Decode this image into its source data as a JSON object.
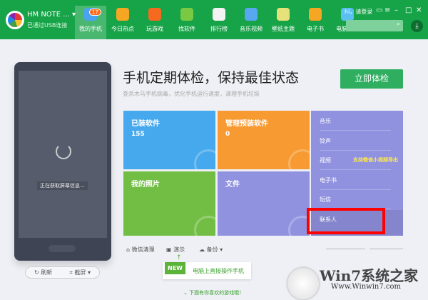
{
  "header": {
    "device": "HM NOTE ...",
    "usb": "已通过USB连接",
    "login": "hi，请登录",
    "badge": "17",
    "nav": [
      {
        "label": "我的手机",
        "color": "#4aa3f0"
      },
      {
        "label": "今日热点",
        "color": "#f5a623"
      },
      {
        "label": "玩游戏",
        "color": "#f56a1e"
      },
      {
        "label": "找软件",
        "color": "#7ac943"
      },
      {
        "label": "排行榜",
        "color": "#f3f3f3"
      },
      {
        "label": "音乐视频",
        "color": "#57a8f0"
      },
      {
        "label": "壁纸主题",
        "color": "#e6e27a"
      },
      {
        "label": "电子书",
        "color": "#f5a623"
      },
      {
        "label": "电脑软件",
        "color": "#5bc0f0"
      }
    ]
  },
  "phone": {
    "loading": "正在获取屏幕信息...",
    "refresh": "刷新",
    "screenshot": "截屏"
  },
  "main": {
    "title": "手机定期体检，保持最佳状态",
    "subtitle": "查杀木马手机病毒，优化手机运行速度，清理手机垃圾",
    "check_button": "立即体检",
    "tiles": [
      {
        "label": "已装软件",
        "count": "155",
        "color": "#46a9ed"
      },
      {
        "label": "管理预装软件",
        "count": "0",
        "color": "#f79a32"
      },
      {
        "label": "我的照片",
        "color": "#72be44"
      },
      {
        "label": "文件",
        "color": "#9092e0"
      }
    ],
    "media": [
      "音乐",
      "铃声",
      "视频",
      "电子书",
      "短信",
      "联系人"
    ],
    "video_note": "支持微信小视频导出"
  },
  "toolbar": {
    "wechat": "微信清理",
    "demo": "演示",
    "backup": "备份"
  },
  "promo": {
    "tag": "NEW",
    "text": "电脑上直接操作手机"
  },
  "footer": "下面有你喜欢的游戏哦！",
  "watermark": {
    "title": "Win7系统之家",
    "url": "Www.Winwin7.com"
  }
}
